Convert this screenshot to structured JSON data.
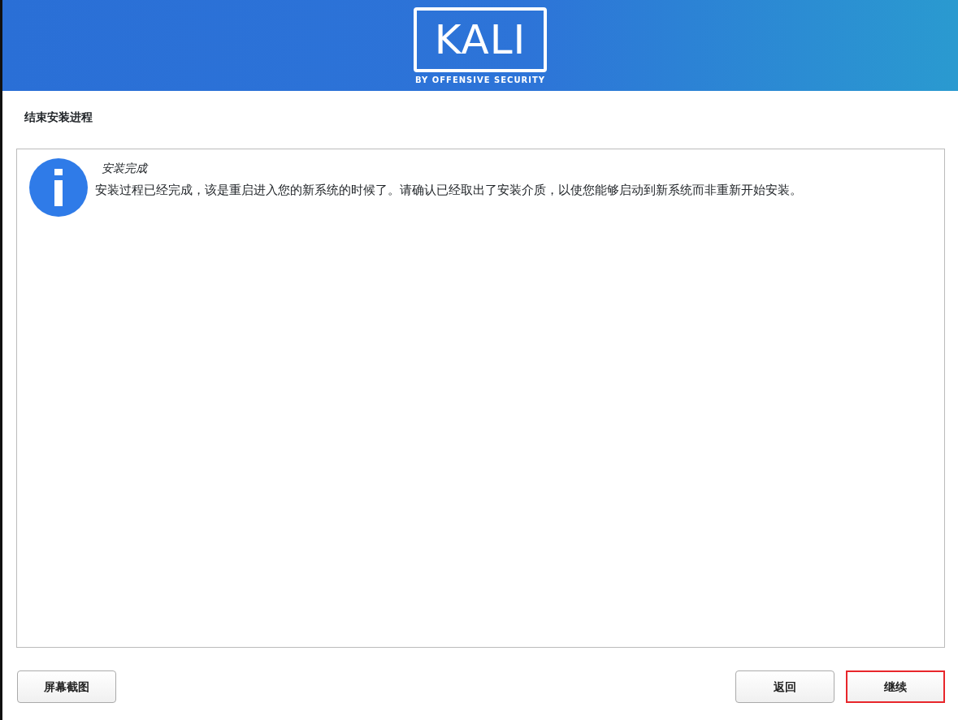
{
  "header": {
    "logo_text": "KALI",
    "logo_tagline": "BY OFFENSIVE SECURITY"
  },
  "page_title": "结束安装进程",
  "message": {
    "kind": "info",
    "title": "安装完成",
    "text": "安装过程已经完成，该是重启进入您的新系统的时候了。请确认已经取出了安装介质，以使您能够启动到新系统而非重新开始安装。"
  },
  "left_buttons": [
    {
      "label": "屏幕截图",
      "highlighted": false
    }
  ],
  "right_buttons": [
    {
      "label": "返回",
      "highlighted": false
    },
    {
      "label": "继续",
      "highlighted": true
    }
  ]
}
